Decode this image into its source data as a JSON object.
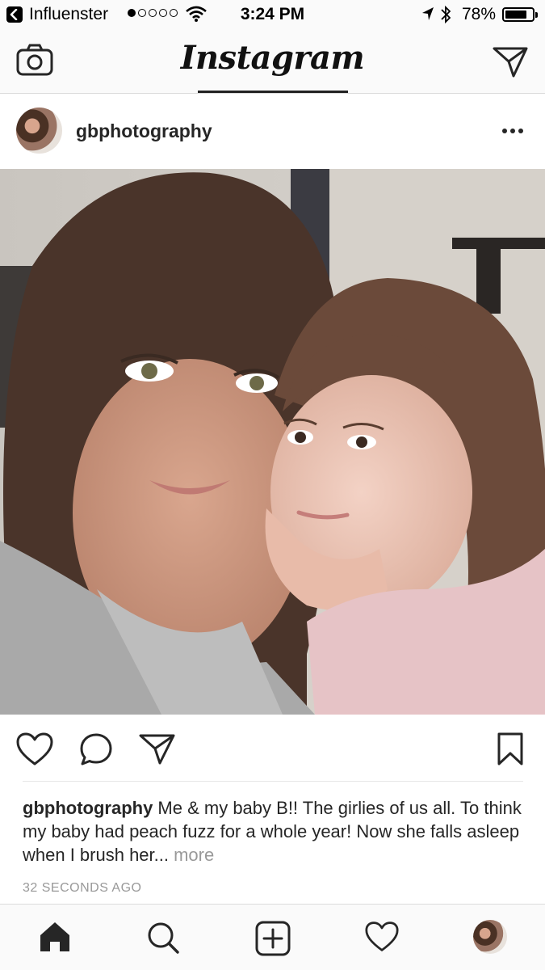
{
  "status_bar": {
    "carrier": "Influenster",
    "time": "3:24 PM",
    "battery": "78%",
    "battery_level": 0.78,
    "signal_bars": 1
  },
  "nav": {
    "title": "Instagram",
    "left_icon": "camera-icon",
    "right_icon": "direct-message-icon"
  },
  "post": {
    "username": "gbphotography",
    "menu_icon": "more-options-icon",
    "photo_alt": "",
    "caption": {
      "user": "gbphotography",
      "text": " Me & my baby B!! The girlies of us all. To think my baby had peach fuzz for a whole year! Now she falls asleep when I brush her... ",
      "more": "more"
    },
    "timestamp": "32 SECONDS AGO"
  },
  "tabs": [
    "home-icon",
    "search-icon",
    "add-post-icon",
    "activity-heart-icon",
    "profile-avatar"
  ],
  "colors": {
    "text": "#262626",
    "muted": "#999999",
    "bar_bg": "#fafafa",
    "border": "#dbdbdb"
  }
}
